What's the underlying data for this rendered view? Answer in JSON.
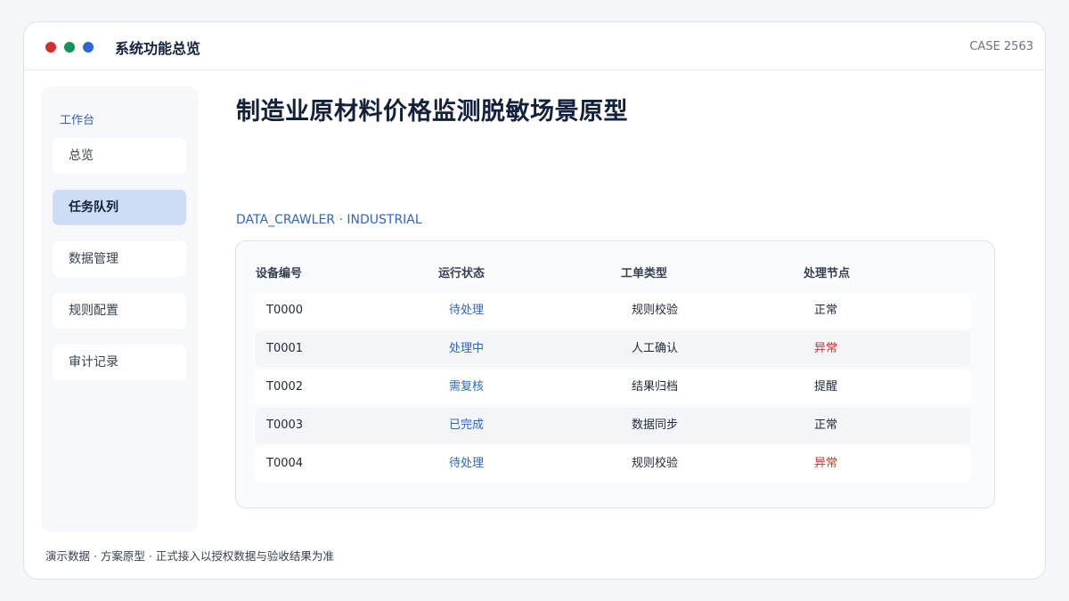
{
  "window": {
    "title": "系统功能总览",
    "case_id": "CASE 2563",
    "dot_colors": [
      "#d32f2f",
      "#12915a",
      "#2f66d6"
    ]
  },
  "sidebar": {
    "heading": "工作台",
    "items": [
      {
        "label": "总览",
        "active": false
      },
      {
        "label": "任务队列",
        "active": true
      },
      {
        "label": "数据管理",
        "active": false
      },
      {
        "label": "规则配置",
        "active": false
      },
      {
        "label": "审计记录",
        "active": false
      }
    ]
  },
  "main": {
    "title": "制造业原材料价格监测脱敏场景原型",
    "subtitle": "DATA_CRAWLER · INDUSTRIAL"
  },
  "table": {
    "headers": [
      "设备编号",
      "运行状态",
      "工单类型",
      "处理节点"
    ],
    "rows": [
      {
        "id": "T0000",
        "status": "待处理",
        "type": "规则校验",
        "node": "正常",
        "node_alert": false
      },
      {
        "id": "T0001",
        "status": "处理中",
        "type": "人工确认",
        "node": "异常",
        "node_alert": true
      },
      {
        "id": "T0002",
        "status": "需复核",
        "type": "结果归档",
        "node": "提醒",
        "node_alert": false
      },
      {
        "id": "T0003",
        "status": "已完成",
        "type": "数据同步",
        "node": "正常",
        "node_alert": false
      },
      {
        "id": "T0004",
        "status": "待处理",
        "type": "规则校验",
        "node": "异常",
        "node_alert": true
      }
    ]
  },
  "footer": {
    "note": "演示数据 · 方案原型 · 正式接入以授权数据与验收结果为准"
  },
  "colors": {
    "accent": "#2f66c0",
    "alert": "#c0392b",
    "active_nav": "#cfdcf6"
  }
}
